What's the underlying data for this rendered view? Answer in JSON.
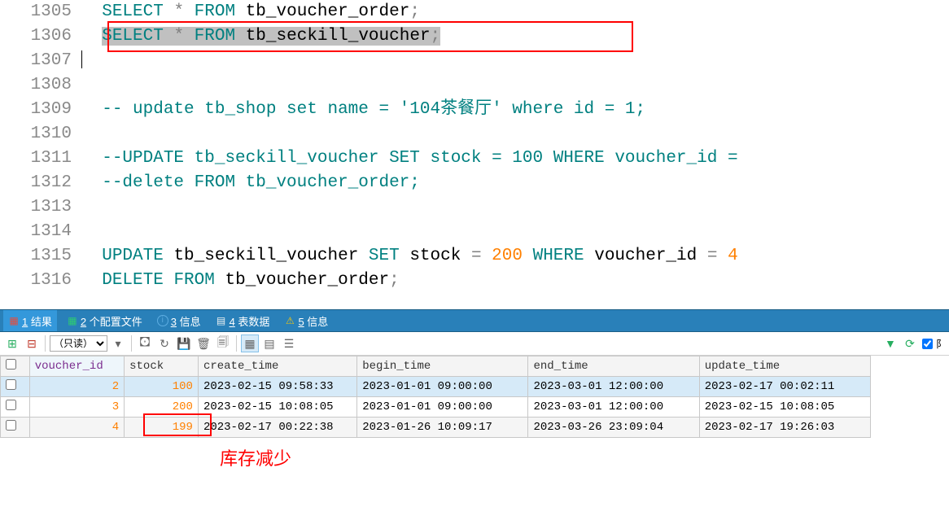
{
  "editor": {
    "lines": [
      {
        "num": "1305",
        "type": "sql",
        "tokens": [
          "SELECT",
          " ",
          "*",
          " ",
          "FROM",
          " ",
          "tb_voucher_order",
          ";"
        ]
      },
      {
        "num": "1306",
        "type": "sql-sel",
        "tokens": [
          "SELECT",
          " ",
          "*",
          " ",
          "FROM",
          " ",
          "tb_seckill_voucher",
          ";"
        ]
      },
      {
        "num": "1307",
        "type": "blank"
      },
      {
        "num": "1308",
        "type": "blank"
      },
      {
        "num": "1309",
        "type": "comment",
        "text": "-- update tb_shop set name = '104茶餐厅' where id = 1;"
      },
      {
        "num": "1310",
        "type": "blank"
      },
      {
        "num": "1311",
        "type": "comment",
        "text": "--UPDATE tb_seckill_voucher SET stock = 100 WHERE voucher_id ="
      },
      {
        "num": "1312",
        "type": "comment",
        "text": "--delete FROM tb_voucher_order;"
      },
      {
        "num": "1313",
        "type": "blank"
      },
      {
        "num": "1314",
        "type": "blank"
      },
      {
        "num": "1315",
        "type": "sql-upd",
        "tokens": [
          "UPDATE",
          " ",
          "tb_seckill_voucher",
          " ",
          "SET",
          " ",
          "stock",
          " ",
          "=",
          " ",
          "200",
          " ",
          "WHERE",
          " ",
          "voucher_id",
          " ",
          "=",
          " ",
          "4"
        ]
      },
      {
        "num": "1316",
        "type": "sql-del",
        "tokens": [
          "DELETE",
          " ",
          "FROM",
          " ",
          "tb_voucher_order",
          ";"
        ]
      }
    ]
  },
  "tabs": [
    {
      "icon": "grid-red",
      "u": "1",
      "label": " 结果",
      "active": true
    },
    {
      "icon": "grid-green",
      "u": "2",
      "label": " 个配置文件"
    },
    {
      "icon": "info",
      "u": "3",
      "label": " 信息"
    },
    {
      "icon": "table",
      "u": "4",
      "label": " 表数据"
    },
    {
      "icon": "warn",
      "u": "5",
      "label": " 信息"
    }
  ],
  "toolbar": {
    "readonly_label": "（只读）"
  },
  "grid": {
    "columns": [
      "voucher_id",
      "stock",
      "create_time",
      "begin_time",
      "end_time",
      "update_time"
    ],
    "rows": [
      {
        "voucher_id": "2",
        "stock": "100",
        "create_time": "2023-02-15 09:58:33",
        "begin_time": "2023-01-01 09:00:00",
        "end_time": "2023-03-01 12:00:00",
        "update_time": "2023-02-17 00:02:11",
        "selected": true
      },
      {
        "voucher_id": "3",
        "stock": "200",
        "create_time": "2023-02-15 10:08:05",
        "begin_time": "2023-01-01 09:00:00",
        "end_time": "2023-03-01 12:00:00",
        "update_time": "2023-02-15 10:08:05"
      },
      {
        "voucher_id": "4",
        "stock": "199",
        "create_time": "2023-02-17 00:22:38",
        "begin_time": "2023-01-26 10:09:17",
        "end_time": "2023-03-26 23:09:04",
        "update_time": "2023-02-17 19:26:03",
        "alt": true
      }
    ]
  },
  "annotation": {
    "stock_reduced": "库存减少"
  }
}
